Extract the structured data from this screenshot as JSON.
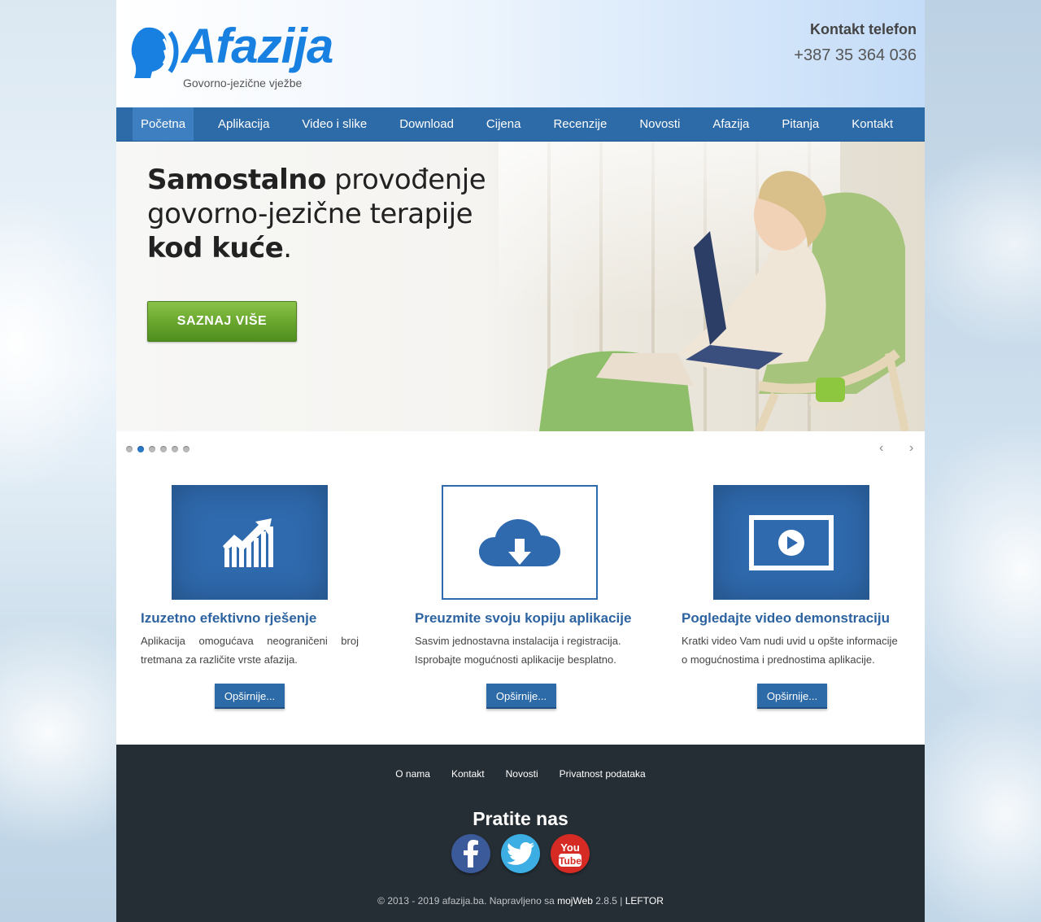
{
  "brand": {
    "name": "Afazija",
    "tagline": "Govorno-jezične vježbe",
    "color": "#1780e0"
  },
  "contact": {
    "title": "Kontakt telefon",
    "phone": "+387 35 364 036"
  },
  "nav": {
    "items": [
      {
        "label": "Početna",
        "active": true
      },
      {
        "label": "Aplikacija"
      },
      {
        "label": "Video i slike"
      },
      {
        "label": "Download"
      },
      {
        "label": "Cijena"
      },
      {
        "label": "Recenzije"
      },
      {
        "label": "Novosti"
      },
      {
        "label": "Afazija"
      },
      {
        "label": "Pitanja"
      },
      {
        "label": "Kontakt"
      }
    ],
    "color": "#2d6aa8"
  },
  "hero": {
    "line1_bold": "Samostalno",
    "line1_rest": " provođenje",
    "line2": "govorno-jezične terapije",
    "line3_bold": "kod kuće",
    "line3_rest": ".",
    "button": "SAZNAJ VIŠE",
    "slides_total": 6,
    "active_slide": 2,
    "prev_icon": "chevron-left-icon",
    "next_icon": "chevron-right-icon"
  },
  "features": [
    {
      "icon": "chart-icon",
      "title": "Izuzetno efektivno rješenje",
      "text": "Aplikacija omogućava neograničeni broj tretmana za različite vrste afazija.",
      "button": "Opširnije..."
    },
    {
      "icon": "cloud-download-icon",
      "title": "Preuzmite svoju kopiju aplikacije",
      "text": "Sasvim jednostavna instalacija i registracija. Isprobajte mogućnosti aplikacije besplatno.",
      "button": "Opširnije..."
    },
    {
      "icon": "video-play-icon",
      "title": "Pogledajte video demonstraciju",
      "text": "Kratki video Vam nudi uvid u opšte informacije o mogućnostima i prednostima aplikacije.",
      "button": "Opširnije..."
    }
  ],
  "footer": {
    "links": [
      "O nama",
      "Kontakt",
      "Novosti",
      "Privatnost podataka"
    ],
    "follow_title": "Pratite nas",
    "socials": [
      "facebook-icon",
      "twitter-icon",
      "youtube-icon"
    ],
    "youtube_you": "You",
    "youtube_tube": "Tube",
    "copyright_pre": "© 2013 - 2019 afazija.ba. Napravljeno sa ",
    "copyright_mojweb": "mojWeb",
    "copyright_version": " 2.8.5 | ",
    "copyright_leftor": "LEFTOR",
    "background": "#262e35"
  }
}
